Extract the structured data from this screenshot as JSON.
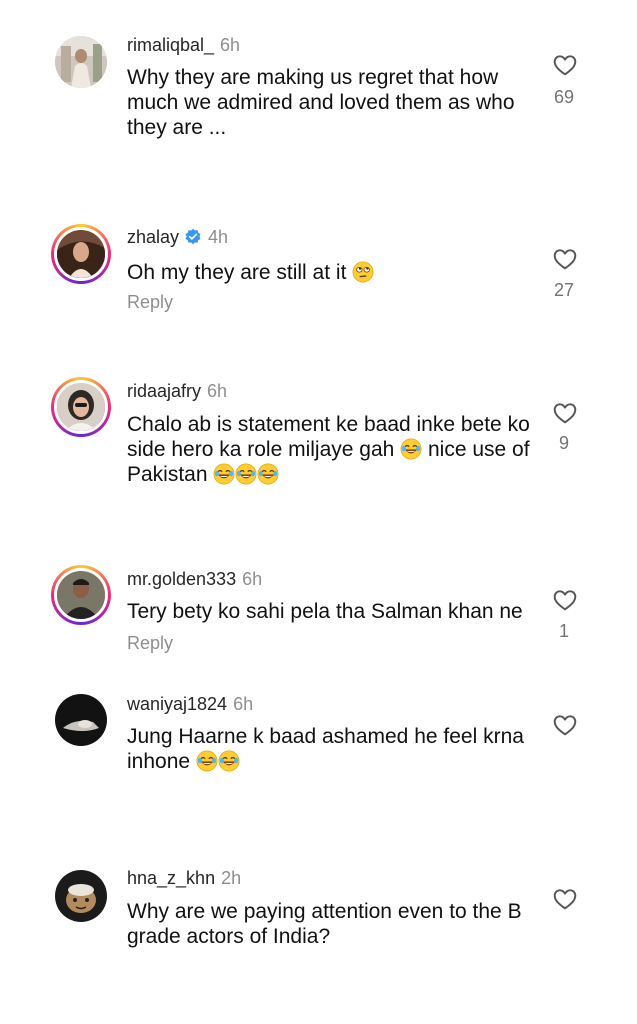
{
  "comments": [
    {
      "username": "rimaliqbal_",
      "time": "6h",
      "text": "Why they are making us regret that how much we admired and loved them as who they are ...",
      "likes": "69",
      "reply": "",
      "verified": false
    },
    {
      "username": "zhalay",
      "time": "4h",
      "text": "Oh my they are still at it",
      "likes": "27",
      "reply": "Reply",
      "verified": true
    },
    {
      "username": "ridaajafry",
      "time": "6h",
      "text_a": "Chalo ab is statement ke baad inke bete ko side hero ka role miljaye gah",
      "text_b": "nice use of Pakistan",
      "likes": "9",
      "reply": "",
      "verified": false
    },
    {
      "username": "mr.golden333",
      "time": "6h",
      "text": "Tery bety ko sahi pela tha Salman khan ne",
      "likes": "1",
      "reply": "Reply",
      "verified": false
    },
    {
      "username": "waniyaj1824",
      "time": "6h",
      "text": "Jung Haarne k baad ashamed he feel krna inhone",
      "likes": "",
      "reply": "",
      "verified": false
    },
    {
      "username": "hna_z_khn",
      "time": "2h",
      "text": "Why are we paying attention even to the B grade actors of India?",
      "likes": "",
      "reply": "",
      "verified": false
    }
  ],
  "icons": {
    "like": "heart-outline-icon",
    "verified": "verified-badge-icon",
    "emoji_laugh": "face-with-tears-of-joy-icon",
    "emoji_eyeroll": "face-with-rolling-eyes-icon"
  },
  "colors": {
    "verified": "#3897f0",
    "muted": "#8e8e8e",
    "story_ring": "#ee2a7b"
  }
}
